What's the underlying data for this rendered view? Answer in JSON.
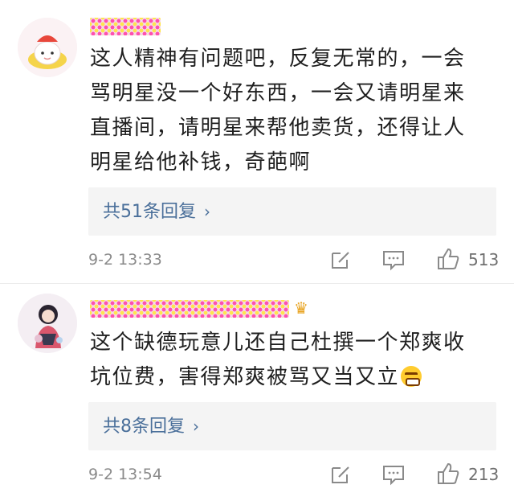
{
  "comments": [
    {
      "text_lines": [
        "这人精神有问题吧，反复无常的，一会",
        "骂明星没一个好东西，一会又请明星来",
        "直播间，请明星来帮他卖货，还得让人",
        "明星给他补钱，奇葩啊"
      ],
      "reply_label": "共51条回复",
      "reply_chevron": "›",
      "time": "9-2 13:33",
      "likes": "513"
    },
    {
      "text_lines": [
        "这个缺德玩意儿还自己杜撰一个郑爽收",
        "坑位费，害得郑爽被骂又当又立"
      ],
      "emoji": "angry-face-emoji",
      "crown_glyph": "♛",
      "reply_label": "共8条回复",
      "reply_chevron": "›",
      "time": "9-2 13:54",
      "likes": "213"
    }
  ],
  "icons": {
    "edit": "edit-icon",
    "comment": "comment-icon",
    "like": "thumbs-up-icon"
  },
  "colors": {
    "link": "#4a6f9a",
    "meta": "#8a8a8a",
    "reply_bg": "#f4f4f4"
  }
}
